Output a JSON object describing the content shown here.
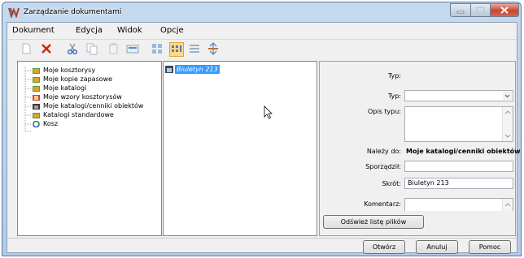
{
  "window": {
    "title": "Zarządzanie dokumentami"
  },
  "menu": [
    "Dokument",
    "Edycja",
    "Widok",
    "Opcje"
  ],
  "toolbar": {
    "buttons": [
      {
        "name": "new-document-icon"
      },
      {
        "name": "delete-icon"
      },
      {
        "name": "cut-icon"
      },
      {
        "name": "copy-icon"
      },
      {
        "name": "paste-icon"
      },
      {
        "name": "properties-icon"
      },
      {
        "name": "large-icons-view-icon"
      },
      {
        "name": "small-icons-view-icon",
        "active": true
      },
      {
        "name": "list-view-icon"
      },
      {
        "name": "details-view-icon"
      }
    ]
  },
  "tree": {
    "items": [
      {
        "label": "Moje kosztorysy"
      },
      {
        "label": "Moje kopie zapasowe"
      },
      {
        "label": "Moje katalogi"
      },
      {
        "label": "Moje wzory kosztorysów"
      },
      {
        "label": "Moje katalogi/cenniki obiektów"
      },
      {
        "label": "Katalogi standardowe"
      },
      {
        "label": "Kosz"
      }
    ]
  },
  "files": {
    "items": [
      {
        "label": "Biuletyn 213",
        "selected": true
      }
    ]
  },
  "properties": {
    "typ_label": "Typ:",
    "typ_value": "",
    "typ2_label": "Typ:",
    "opis_label": "Opis typu:",
    "nalezy_label": "Należy do:",
    "nalezy_value": "Moje katalogi/cenniki obiektów",
    "sporzadzil_label": "Sporządził:",
    "sporzadzil_value": "",
    "skrot_label": "Skrót:",
    "skrot_value": "Biuletyn 213",
    "komentarz_label": "Komentarz:",
    "refresh_label": "Odśwież listę plików"
  },
  "footer": {
    "open_label": "Otwórz",
    "cancel_label": "Anuluj",
    "help_label": "Pomoc"
  }
}
